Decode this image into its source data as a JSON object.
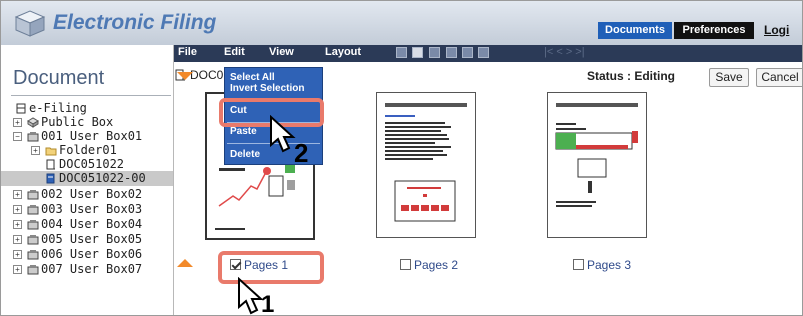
{
  "header": {
    "title": "Electronic Filing",
    "tab_documents": "Documents",
    "tab_preferences": "Preferences",
    "logout": "Logi"
  },
  "menubar": {
    "items": [
      "File",
      "Edit",
      "View",
      "Layout"
    ],
    "pager": "|<  <  >  >|"
  },
  "sidebar": {
    "title": "Document",
    "tree": [
      {
        "label": "e-Filing",
        "icon": "cabinet-icon",
        "toggle": ""
      },
      {
        "label": "Public Box",
        "icon": "box-icon",
        "toggle": "+"
      },
      {
        "label": "001 User Box01",
        "icon": "userbox-icon",
        "toggle": "−"
      },
      {
        "label": "Folder01",
        "icon": "folder-icon",
        "toggle": "+"
      },
      {
        "label": "DOC051022",
        "icon": "document-icon",
        "toggle": ""
      },
      {
        "label": "DOC051022-00",
        "icon": "document-icon",
        "toggle": ""
      },
      {
        "label": "002 User Box02",
        "icon": "userbox-icon",
        "toggle": "+"
      },
      {
        "label": "003 User Box03",
        "icon": "userbox-icon",
        "toggle": "+"
      },
      {
        "label": "004 User Box04",
        "icon": "userbox-icon",
        "toggle": "+"
      },
      {
        "label": "005 User Box05",
        "icon": "userbox-icon",
        "toggle": "+"
      },
      {
        "label": "006 User Box06",
        "icon": "userbox-icon",
        "toggle": "+"
      },
      {
        "label": "007 User Box07",
        "icon": "userbox-icon",
        "toggle": "+"
      }
    ]
  },
  "main": {
    "doc_name": "DOC0",
    "status": "Status : Editing",
    "save": "Save",
    "cancel": "Cancel",
    "pages": [
      {
        "label": "Pages 1",
        "checked": true
      },
      {
        "label": "Pages 2",
        "checked": false
      },
      {
        "label": "Pages 3",
        "checked": false
      }
    ]
  },
  "context_menu": {
    "select_all": "Select All",
    "invert_selection": "Invert Selection",
    "cut": "Cut",
    "paste": "Paste",
    "delete": "Delete"
  },
  "callouts": {
    "step1": "1",
    "step2": "2"
  },
  "colors": {
    "accent": "#1f5fb8",
    "highlight": "#e97a6b",
    "menu": "#2f62b6",
    "arrow": "#f28a2b"
  }
}
